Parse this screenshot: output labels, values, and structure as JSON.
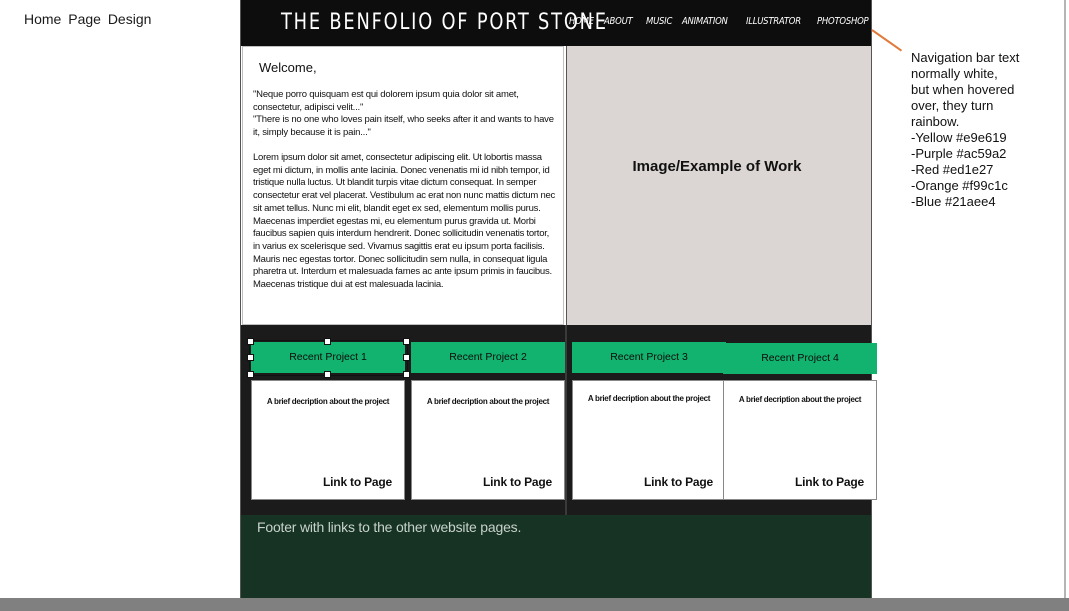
{
  "doc_label": "Home Page Design",
  "site": {
    "title": "THE BENFOLIO OF PORT STONE",
    "nav": [
      "HOME",
      "ABOUT",
      "MUSIC",
      "ANIMATION",
      "ILLUSTRATOR",
      "PHOTOSHOP"
    ]
  },
  "welcome": {
    "title": "Welcome,",
    "quote_1": "\"Neque porro quisquam est qui dolorem ipsum quia dolor sit amet, consectetur, adipisci velit...\"",
    "quote_2": "\"There is no one who loves pain itself, who seeks after it and wants to have it, simply because it is pain...\"",
    "body": "Lorem ipsum dolor sit amet, consectetur adipiscing elit. Ut lobortis massa eget mi dictum, in mollis ante lacinia. Donec venenatis mi id nibh tempor, id tristique nulla luctus. Ut blandit turpis vitae dictum consequat. In semper consectetur erat vel placerat. Vestibulum ac erat non nunc mattis dictum nec sit amet tellus. Nunc mi elit, blandit eget ex sed, elementum mollis purus. Maecenas imperdiet egestas mi, eu elementum purus gravida ut. Morbi faucibus sapien quis interdum hendrerit. Donec sollicitudin venenatis tortor, in varius ex scelerisque sed. Vivamus sagittis erat eu ipsum porta facilisis. Mauris nec egestas tortor. Donec sollicitudin sem nulla, in consequat ligula pharetra ut. Interdum et malesuada fames ac ante ipsum primis in faucibus. Maecenas tristique dui at est malesuada lacinia."
  },
  "image_panel": {
    "label": "Image/Example of Work"
  },
  "projects": [
    {
      "title": "Recent Project 1",
      "description": "A brief decription about the project",
      "link": "Link to Page"
    },
    {
      "title": "Recent Project 2",
      "description": "A brief decription about the project",
      "link": "Link to Page"
    },
    {
      "title": "Recent Project 3",
      "description": "A brief decription about the project",
      "link": "Link to Page"
    },
    {
      "title": "Recent Project 4",
      "description": "A brief decription about the project",
      "link": "Link to Page"
    }
  ],
  "footer": {
    "text": "Footer  with links to the other website pages."
  },
  "annotation": {
    "lines": [
      "Navigation bar text",
      "normally white,",
      "but when hovered",
      "over, they turn",
      "rainbow.",
      "-Yellow #e9e619",
      "-Purple #ac59a2",
      "-Red #ed1e27",
      "-Orange #f99c1c",
      "-Blue #21aee4"
    ]
  },
  "colors": {
    "header_bg": "#0d0d0d",
    "button_green": "#12b36f",
    "footer_bg": "#163323",
    "image_placeholder": "#dbd6d3",
    "callout_line": "#e07a3a"
  }
}
